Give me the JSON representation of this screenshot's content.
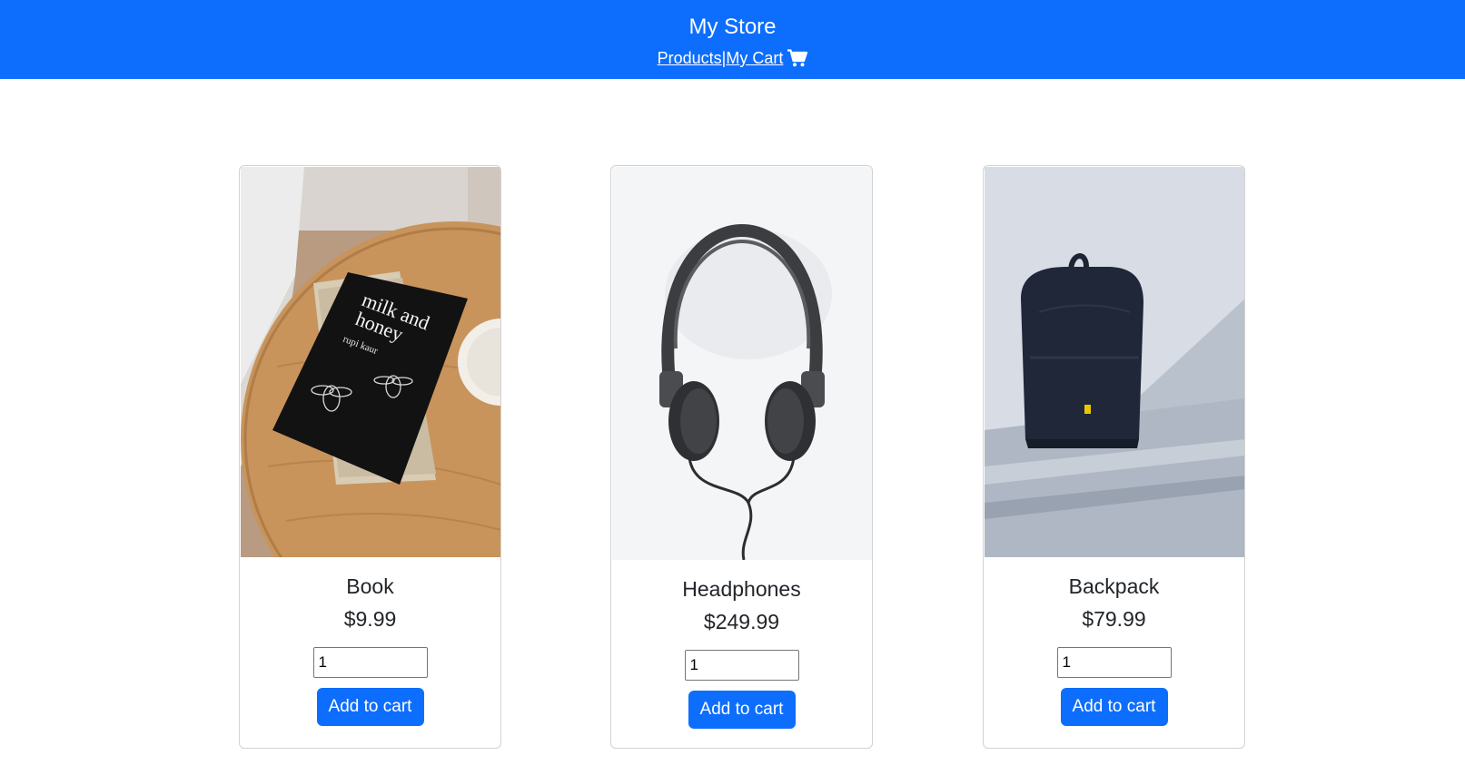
{
  "header": {
    "title": "My Store",
    "nav": {
      "products_label": "Products",
      "separator": "|",
      "cart_label": "My Cart",
      "cart_icon": "shopping-cart-icon"
    }
  },
  "colors": {
    "primary": "#0d6efd",
    "text": "#212529",
    "card_border": "#d9d9d9"
  },
  "products": [
    {
      "name": "Book",
      "price": "$9.99",
      "quantity": "1",
      "button_label": "Add to cart",
      "image": "book-on-wooden-table-photo",
      "book_title_line1": "milk and",
      "book_title_line2": "honey",
      "book_author": "rupi kaur"
    },
    {
      "name": "Headphones",
      "price": "$249.99",
      "quantity": "1",
      "button_label": "Add to cart",
      "image": "headphones-photo"
    },
    {
      "name": "Backpack",
      "price": "$79.99",
      "quantity": "1",
      "button_label": "Add to cart",
      "image": "backpack-photo"
    }
  ]
}
